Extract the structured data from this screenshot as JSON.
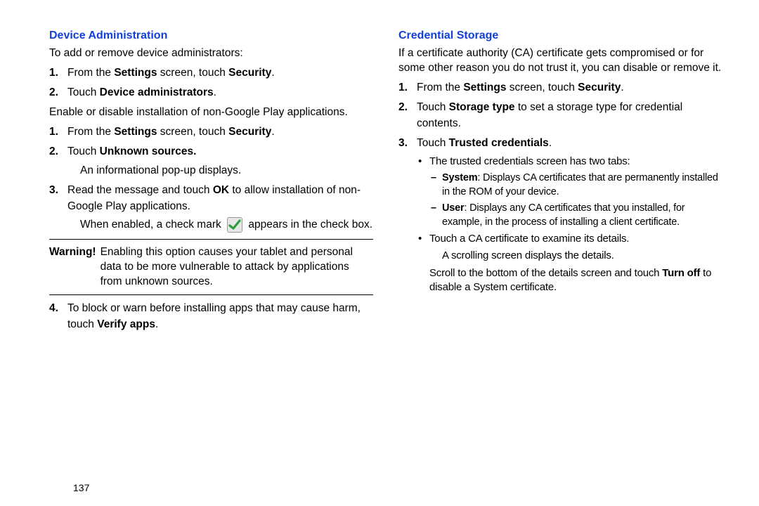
{
  "page_number": "137",
  "left": {
    "heading": "Device Administration",
    "intro1": "To add or remove device administrators:",
    "step1_num": "1.",
    "step1_a": "From the ",
    "step1_b": "Settings",
    "step1_c": " screen, touch ",
    "step1_d": "Security",
    "step1_e": ".",
    "step2_num": "2.",
    "step2_a": "Touch ",
    "step2_b": "Device administrators",
    "step2_c": ".",
    "intro2": "Enable or disable installation of non-Google Play applications.",
    "b1_num": "1.",
    "b1_a": "From the ",
    "b1_b": "Settings",
    "b1_c": " screen, touch ",
    "b1_d": "Security",
    "b1_e": ".",
    "b2_num": "2.",
    "b2_a": "Touch ",
    "b2_b": "Unknown sources.",
    "b2_line2": "An informational pop-up displays.",
    "b3_num": "3.",
    "b3_a": "Read the message and touch ",
    "b3_b": "OK",
    "b3_c": " to allow installation of non-Google Play applications.",
    "b3_line2a": "When enabled, a check mark ",
    "b3_line2b": " appears in the check box.",
    "warn_label": "Warning!",
    "warn_text": "Enabling this option causes your tablet and personal data to be more vulnerable to attack by applications from unknown sources.",
    "b4_num": "4.",
    "b4_a": "To block or warn before installing apps that may cause harm, touch ",
    "b4_b": "Verify apps",
    "b4_c": "."
  },
  "right": {
    "heading": "Credential Storage",
    "intro": "If a certificate authority (CA) certificate gets compromised or for some other reason you do not trust it, you can disable or remove it.",
    "s1_num": "1.",
    "s1_a": "From the ",
    "s1_b": "Settings",
    "s1_c": " screen, touch ",
    "s1_d": "Security",
    "s1_e": ".",
    "s2_num": "2.",
    "s2_a": "Touch ",
    "s2_b": "Storage type",
    "s2_c": " to set a storage type for credential contents.",
    "s3_num": "3.",
    "s3_a": "Touch ",
    "s3_b": "Trusted credentials",
    "s3_c": ".",
    "bul1": "The trusted credentials screen has two tabs:",
    "d1a": "System",
    "d1b": ": Displays CA certificates that are permanently installed in the ROM of your device.",
    "d2a": "User",
    "d2b": ": Displays any CA certificates that you installed, for example, in the process of installing a client certificate.",
    "bul2": "Touch a CA certificate to examine its details.",
    "bul2_sub": "A scrolling screen displays the details.",
    "scroll_a": "Scroll to the bottom of the details screen and touch ",
    "scroll_b": "Turn off",
    "scroll_c": " to disable a System certificate."
  }
}
